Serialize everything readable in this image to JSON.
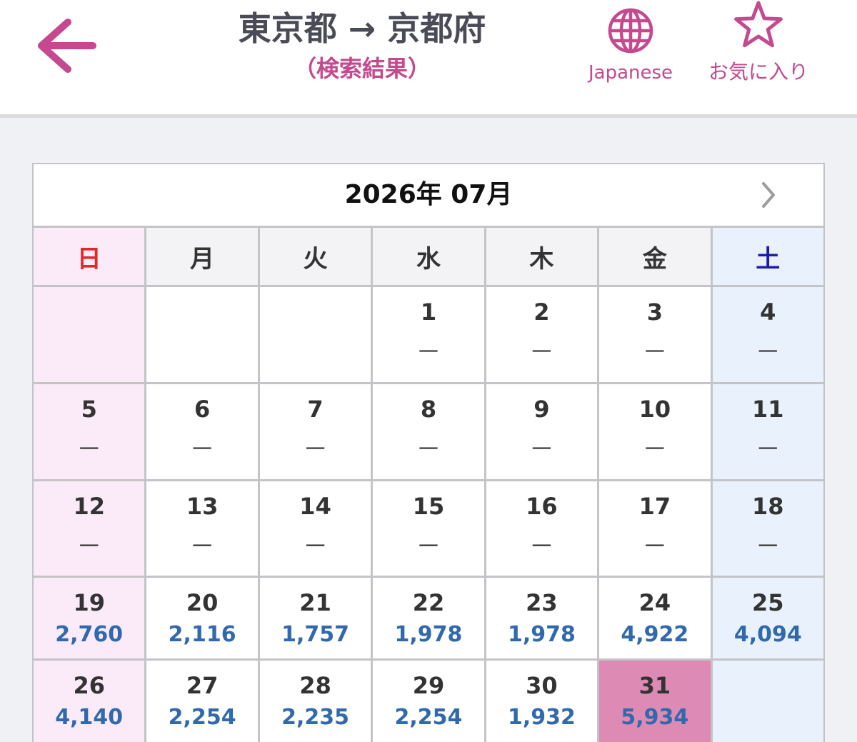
{
  "header": {
    "back_icon": "arrow-left-icon",
    "title": "東京都 → 京都府",
    "subtitle": "（検索結果）",
    "language": {
      "icon": "globe-icon",
      "label": "Japanese"
    },
    "favorite": {
      "icon": "star-outline-icon",
      "label": "お気に入り"
    }
  },
  "calendar": {
    "month_label": "2026年 07月",
    "next_month_icon": "chevron-right-icon",
    "weekdays": [
      "日",
      "月",
      "火",
      "水",
      "木",
      "金",
      "土"
    ],
    "highlighted_day": "31",
    "weeks": [
      [
        null,
        null,
        null,
        {
          "day": "1",
          "price": "—"
        },
        {
          "day": "2",
          "price": "—"
        },
        {
          "day": "3",
          "price": "—"
        },
        {
          "day": "4",
          "price": "—"
        }
      ],
      [
        {
          "day": "5",
          "price": "—"
        },
        {
          "day": "6",
          "price": "—"
        },
        {
          "day": "7",
          "price": "—"
        },
        {
          "day": "8",
          "price": "—"
        },
        {
          "day": "9",
          "price": "—"
        },
        {
          "day": "10",
          "price": "—"
        },
        {
          "day": "11",
          "price": "—"
        }
      ],
      [
        {
          "day": "12",
          "price": "—"
        },
        {
          "day": "13",
          "price": "—"
        },
        {
          "day": "14",
          "price": "—"
        },
        {
          "day": "15",
          "price": "—"
        },
        {
          "day": "16",
          "price": "—"
        },
        {
          "day": "17",
          "price": "—"
        },
        {
          "day": "18",
          "price": "—"
        }
      ],
      [
        {
          "day": "19",
          "price": "2,760"
        },
        {
          "day": "20",
          "price": "2,116"
        },
        {
          "day": "21",
          "price": "1,757"
        },
        {
          "day": "22",
          "price": "1,978"
        },
        {
          "day": "23",
          "price": "1,978"
        },
        {
          "day": "24",
          "price": "4,922"
        },
        {
          "day": "25",
          "price": "4,094"
        }
      ],
      [
        {
          "day": "26",
          "price": "4,140"
        },
        {
          "day": "27",
          "price": "2,254"
        },
        {
          "day": "28",
          "price": "2,235"
        },
        {
          "day": "29",
          "price": "2,254"
        },
        {
          "day": "30",
          "price": "1,932"
        },
        {
          "day": "31",
          "price": "5,934"
        },
        null
      ]
    ]
  },
  "colors": {
    "accent": "#c4498e",
    "title_text": "#4b4b57",
    "sunday_text": "#e0282a",
    "saturday_text": "#1c1ca6",
    "sunday_bg": "#fbeaf8",
    "saturday_bg": "#e9f2fc",
    "weekday_header_bg": "#f3f3f5",
    "price_text": "#3169ad",
    "highlight_bg": "#dd8bb4",
    "grid_line": "#c4c4c8",
    "page_bg": "#f0f1f5"
  }
}
